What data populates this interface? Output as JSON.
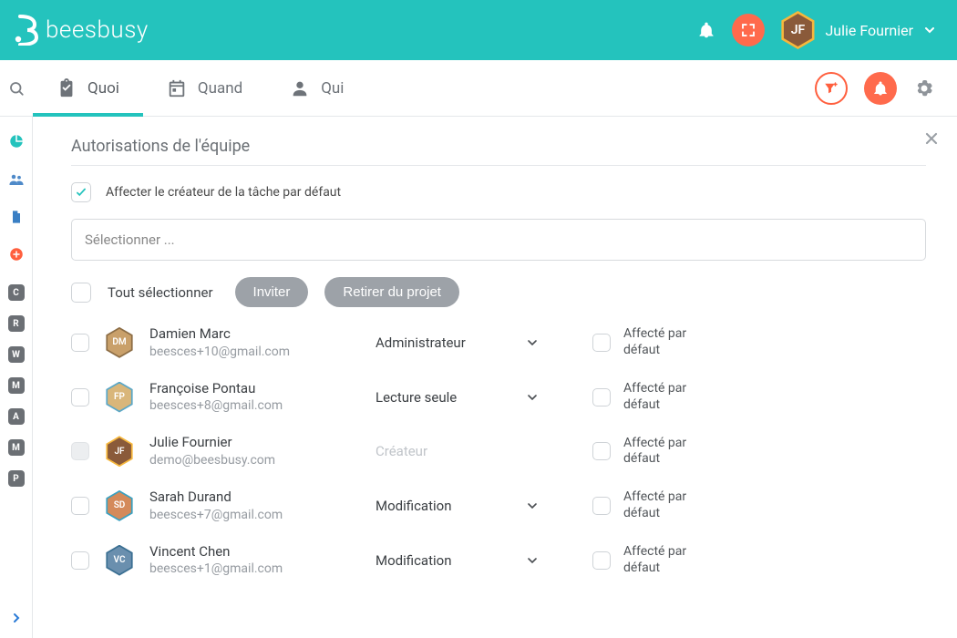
{
  "brand": {
    "name": "beesbusy"
  },
  "top": {
    "user_name": "Julie Fournier"
  },
  "tabs": {
    "quoi": "Quoi",
    "quand": "Quand",
    "qui": "Qui"
  },
  "rail": {
    "badges": [
      "C",
      "R",
      "W",
      "M",
      "A",
      "M",
      "P"
    ]
  },
  "panel": {
    "title": "Autorisations de l'équipe",
    "default_assign": "Affecter le créateur de la tâche par défaut",
    "input_placeholder": "Sélectionner ...",
    "select_all": "Tout sélectionner",
    "invite": "Inviter",
    "remove": "Retirer du projet",
    "assigned_label": "Affecté par défaut"
  },
  "roles": {
    "admin": "Administrateur",
    "readonly": "Lecture seule",
    "creator": "Créateur",
    "modify": "Modification"
  },
  "members": [
    {
      "name": "Damien Marc",
      "email": "beesces+10@gmail.com",
      "role_key": "admin",
      "role_editable": true,
      "selectable": true,
      "avatar_bg": "#c9a06a",
      "avatar_border": "#8c6d45"
    },
    {
      "name": "Françoise Pontau",
      "email": "beesces+8@gmail.com",
      "role_key": "readonly",
      "role_editable": true,
      "selectable": true,
      "avatar_bg": "#d9b67a",
      "avatar_border": "#5aa7c7"
    },
    {
      "name": "Julie Fournier",
      "email": "demo@beesbusy.com",
      "role_key": "creator",
      "role_editable": false,
      "selectable": false,
      "avatar_bg": "#8a5a3a",
      "avatar_border": "#f6b73c"
    },
    {
      "name": "Sarah Durand",
      "email": "beesces+7@gmail.com",
      "role_key": "modify",
      "role_editable": true,
      "selectable": true,
      "avatar_bg": "#d48a5a",
      "avatar_border": "#3aa0c0"
    },
    {
      "name": "Vincent Chen",
      "email": "beesces+1@gmail.com",
      "role_key": "modify",
      "role_editable": true,
      "selectable": true,
      "avatar_bg": "#6a8fae",
      "avatar_border": "#3a6f92"
    }
  ]
}
